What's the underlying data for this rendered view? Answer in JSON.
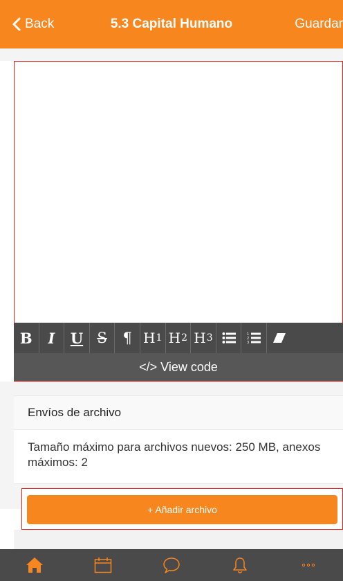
{
  "header": {
    "back_label": "Back",
    "title": "5.3 Capital Humano",
    "save_label": "Guardar"
  },
  "editor": {
    "toolbar": [
      {
        "name": "bold",
        "label": "B"
      },
      {
        "name": "italic",
        "label": "I"
      },
      {
        "name": "underline",
        "label": "U"
      },
      {
        "name": "strikethrough",
        "label": "S"
      },
      {
        "name": "paragraph",
        "label": "¶"
      },
      {
        "name": "heading-1",
        "label": "H",
        "level": "1"
      },
      {
        "name": "heading-2",
        "label": "H",
        "level": "2"
      },
      {
        "name": "heading-3",
        "label": "H",
        "level": "3"
      },
      {
        "name": "bullet-list",
        "icon": "bullet-list-icon"
      },
      {
        "name": "numbered-list",
        "icon": "numbered-list-icon"
      },
      {
        "name": "clear-format",
        "icon": "eraser-icon"
      }
    ],
    "view_code_label": "</> View code"
  },
  "files": {
    "section_title": "Envíos de archivo",
    "info_text": "Tamaño máximo para archivos nuevos: 250 MB, anexos máximos: 2",
    "add_button_label": "+ Añadir archivo"
  },
  "tabbar": {
    "items": [
      {
        "name": "home",
        "icon": "home-icon",
        "active": true
      },
      {
        "name": "calendar",
        "icon": "calendar-icon"
      },
      {
        "name": "messages",
        "icon": "chat-bubble-icon"
      },
      {
        "name": "notifications",
        "icon": "bell-icon"
      },
      {
        "name": "more",
        "icon": "more-dots-icon"
      }
    ]
  },
  "colors": {
    "accent": "#f7861e",
    "toolbar": "#4a4a4a",
    "highlight_border": "#e2231a"
  }
}
